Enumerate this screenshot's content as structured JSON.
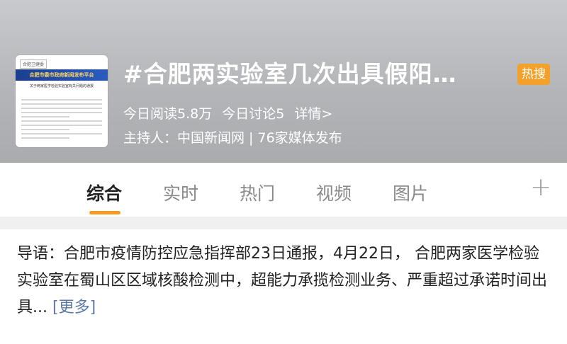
{
  "topic": {
    "title": "#合肥两实验室几次出具假阳…",
    "hot_badge": "热搜",
    "read_count": "今日阅读5.8万",
    "discuss_count": "今日讨论5",
    "detail_link": "详情>",
    "host": "主持人：中国新闻网 | 76家媒体发布"
  },
  "thumbnail": {
    "tag": "合肥卫健委",
    "banner": "合肥市委市政府新闻发布平台",
    "doc_title": "关于两家医学检验实验室有关问题的通报"
  },
  "tabs": [
    {
      "label": "综合"
    },
    {
      "label": "实时"
    },
    {
      "label": "热门"
    },
    {
      "label": "视频"
    },
    {
      "label": "图片"
    }
  ],
  "intro": {
    "text": "导语：合肥市疫情防控应急指挥部23日通报，4月22日， 合肥两家医学检验实验室在蜀山区区域核酸检测中，超能力承揽检测业务、严重超过承诺时间出具...",
    "more": "[更多]"
  },
  "colors": {
    "hot_badge": "#f3a12a",
    "tab_underline": "#f49c25",
    "link": "#5b7aa8"
  }
}
